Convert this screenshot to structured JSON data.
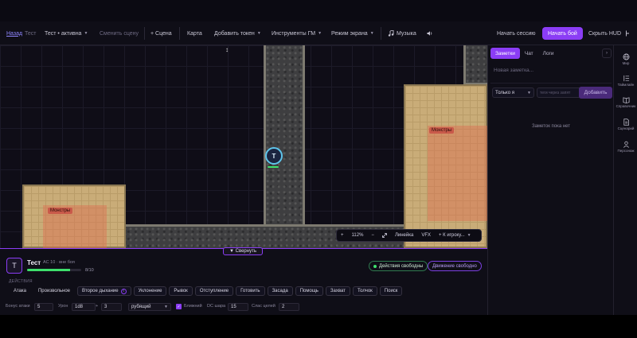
{
  "topbar": {
    "back": "Назад",
    "scene_name": "Тест",
    "scene_select": "Тест • активна",
    "switch_scene": "Сменить сцену",
    "add_scene": "+ Сцена",
    "map": "Карта",
    "add_token": "Добавить токен",
    "gm_tools": "Инструменты ГМ",
    "screen_mode": "Режим экрана",
    "music": "Музыка",
    "start_session": "Начать сессию",
    "start_battle": "Начать бой",
    "hide_hud": "Скрыть HUD"
  },
  "map": {
    "monsters_label_1": "Монстры",
    "monsters_label_2": "Монстры",
    "token_letter": "Т",
    "toolbar": {
      "plus": "+",
      "zoom": "112%",
      "minus": "−",
      "ruler": "Линейка",
      "vfx": "VFX",
      "to_player": "+ К игроку..."
    }
  },
  "collapse": "▼ Свернуть",
  "character": {
    "avatar_letter": "Т",
    "name": "Тест",
    "meta": "AC 10 · вне боя",
    "hp_text": "8/10",
    "hp_fraction": 0.8,
    "free_actions": "Действия свободны",
    "free_movement": "Движение свободно"
  },
  "actions": {
    "label": "ДЕЙСТВИЯ",
    "items": [
      "Атака",
      "Произвольное",
      "Второе дыхание",
      "Уклонение",
      "Рывок",
      "Отступление",
      "Готовить",
      "Засада",
      "Помощь",
      "Захват",
      "Толчок",
      "Поиск"
    ]
  },
  "form": {
    "attack_bonus_label": "Бонус атаки",
    "attack_bonus": "5",
    "damage_label": "Урон",
    "damage": "1d8",
    "plus": "+",
    "damage_mod": "3",
    "damage_type": "рубящий",
    "melee_label": "Ближний",
    "dc_label": "DC шара",
    "dc": "15",
    "slot_label": "Слас целей",
    "slot": "2"
  },
  "right_panel": {
    "tabs": [
      "Заметки",
      "Чат",
      "Логи"
    ],
    "new_note": "Новая заметка...",
    "visibility": "Только я",
    "tags_placeholder": "теги через запят",
    "add": "Добавить",
    "empty": "Заметок пока нет"
  },
  "sidebar": {
    "items": [
      {
        "label": "Мир",
        "icon": "globe-icon"
      },
      {
        "label": "Таймлайн",
        "icon": "timeline-icon"
      },
      {
        "label": "Справочник",
        "icon": "book-icon"
      },
      {
        "label": "Сценарий",
        "icon": "document-icon"
      },
      {
        "label": "Персонаж",
        "icon": "person-icon"
      }
    ]
  }
}
